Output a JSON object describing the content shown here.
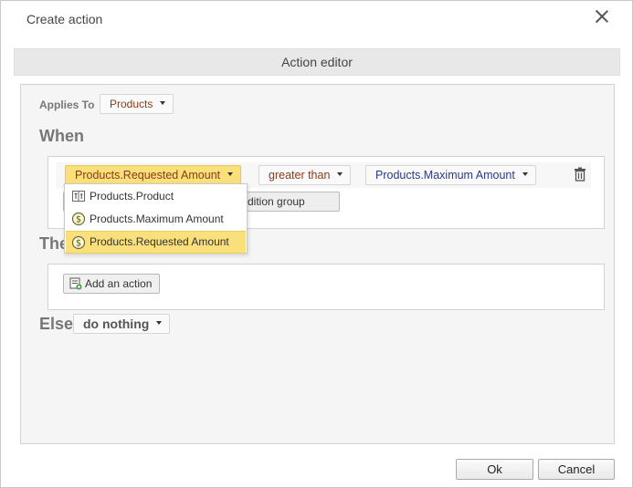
{
  "dialog": {
    "title": "Create action",
    "header": "Action editor",
    "ok_label": "Ok",
    "cancel_label": "Cancel"
  },
  "applies_to": {
    "label": "Applies To",
    "value": "Products"
  },
  "when": {
    "title": "When",
    "condition": {
      "field": "Products.Requested Amount",
      "operator": "greater than",
      "value": "Products.Maximum Amount"
    },
    "group_button_visible_text": "dition group"
  },
  "field_menu": {
    "items": [
      {
        "label": "Products.Product",
        "icon": "text-field-icon",
        "selected": false
      },
      {
        "label": "Products.Maximum Amount",
        "icon": "currency-icon",
        "selected": false
      },
      {
        "label": "Products.Requested Amount",
        "icon": "currency-icon",
        "selected": true
      }
    ]
  },
  "then": {
    "title_visible_text": "The",
    "add_action_label": "Add an action"
  },
  "else": {
    "title": "Else",
    "value": "do nothing"
  },
  "colors": {
    "highlight": "#f9e07a",
    "field_text": "#8b3a1a",
    "value_text": "#2a3a8a"
  }
}
